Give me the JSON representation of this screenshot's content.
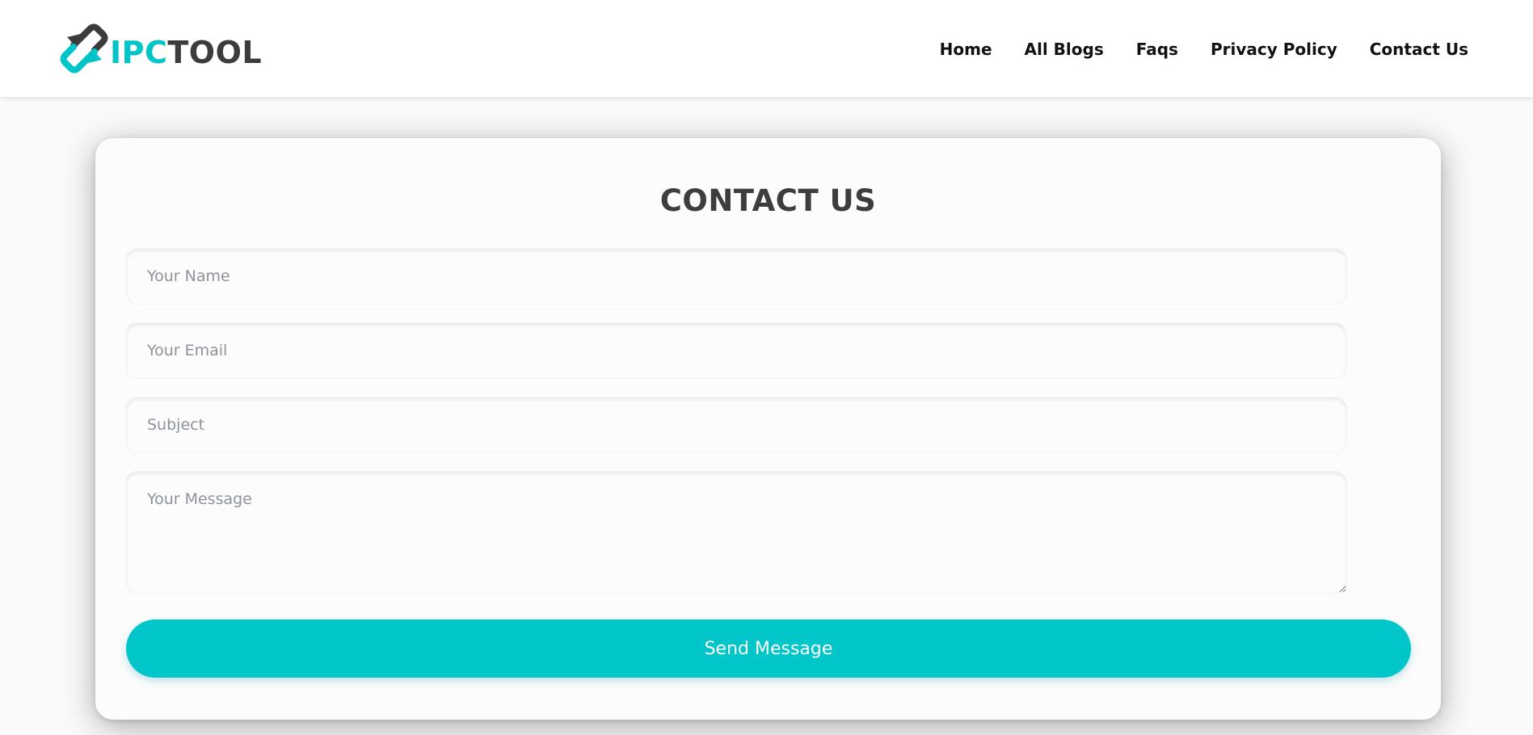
{
  "brand": {
    "logo_icon": "two-arrows-exchange-icon",
    "name_accent": "IPC",
    "name_rest": "TOOL",
    "accent_color": "#00c4c8",
    "dark_color": "#3c3c3c"
  },
  "nav": {
    "items": [
      {
        "label": "Home"
      },
      {
        "label": "All Blogs"
      },
      {
        "label": "Faqs"
      },
      {
        "label": "Privacy Policy"
      },
      {
        "label": "Contact Us"
      }
    ]
  },
  "contact": {
    "title": "CONTACT US",
    "name_placeholder": "Your Name",
    "email_placeholder": "Your Email",
    "subject_placeholder": "Subject",
    "message_placeholder": "Your Message",
    "submit_label": "Send Message",
    "button_color": "#00c5c9"
  }
}
